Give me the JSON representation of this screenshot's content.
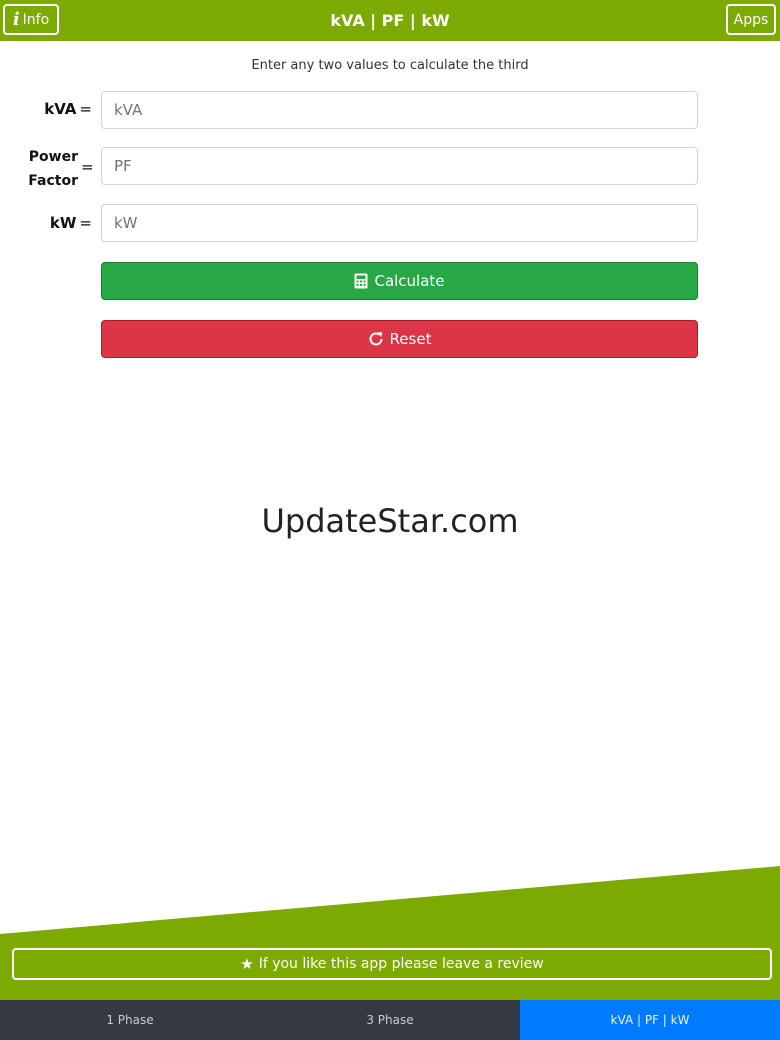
{
  "header": {
    "info_label": "Info",
    "title": "kVA | PF | kW",
    "apps_label": "Apps"
  },
  "instruction": "Enter any two values to calculate the third",
  "fields": {
    "kva": {
      "label": "kVA",
      "equals": "=",
      "placeholder": "kVA",
      "value": ""
    },
    "pf": {
      "label_line1": "Power",
      "label_line2": "Factor",
      "equals": "=",
      "placeholder": "PF",
      "value": ""
    },
    "kw": {
      "label": "kW",
      "equals": "=",
      "placeholder": "kW",
      "value": ""
    }
  },
  "buttons": {
    "calculate": "Calculate",
    "reset": "Reset"
  },
  "watermark": "UpdateStar.com",
  "review": "If you like this app please leave a review",
  "tabs": [
    "1 Phase",
    "3 Phase",
    "kVA | PF | kW"
  ],
  "active_tab": "kVA | PF | kW",
  "colors": {
    "brand_green": "#7daa00",
    "calculate": "#28a745",
    "reset": "#dc3545",
    "tab_active": "#007bff",
    "tabbar": "#343a40"
  },
  "icons": {
    "info": "info-icon",
    "calculate": "calculator-icon",
    "reset": "reset-icon",
    "review": "star-icon"
  }
}
